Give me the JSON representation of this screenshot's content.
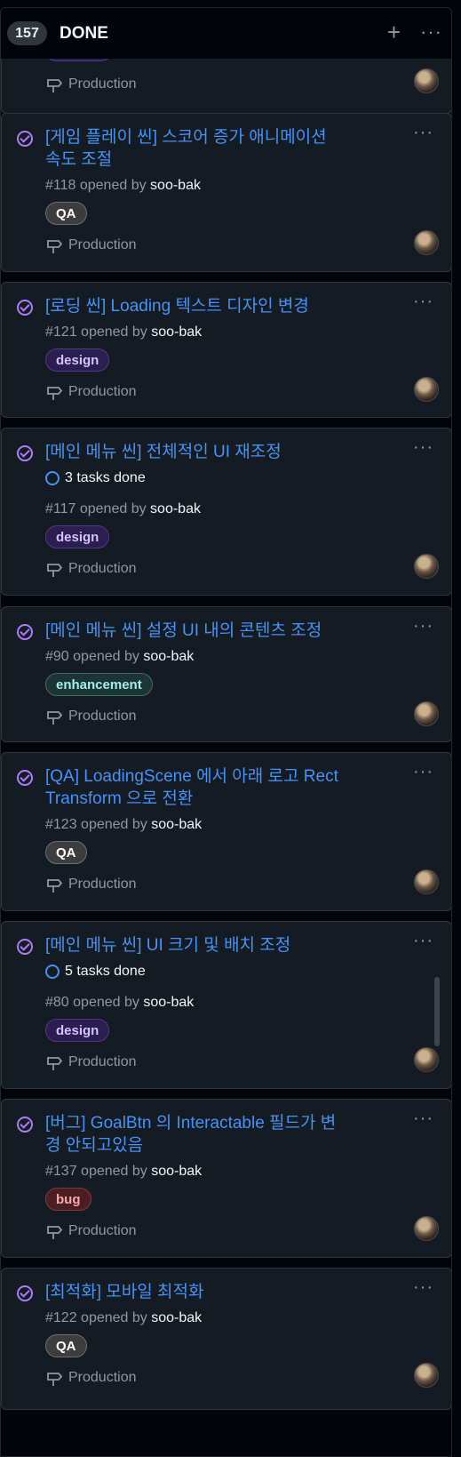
{
  "column": {
    "count": "157",
    "title": "DONE",
    "add_icon": "plus-icon",
    "more_icon": "kebab-horizontal-icon"
  },
  "partial_card": {
    "milestone": "Production"
  },
  "cards": [
    {
      "title_line1": "[게임 플레이 씬] 스코어 증가 애니메이션",
      "title_line2": "속도 조절",
      "number": "#118",
      "opened_by": "opened by",
      "author": "soo-bak",
      "label": "QA",
      "milestone": "Production"
    },
    {
      "title_line1": "[로딩 씬] Loading 텍스트 디자인 변경",
      "number": "#121",
      "opened_by": "opened by",
      "author": "soo-bak",
      "label": "design",
      "milestone": "Production"
    },
    {
      "title_line1": "[메인 메뉴 씬] 전체적인 UI 재조정",
      "tasks": "3 tasks done",
      "number": "#117",
      "opened_by": "opened by",
      "author": "soo-bak",
      "label": "design",
      "milestone": "Production"
    },
    {
      "title_line1": "[메인 메뉴 씬] 설정 UI 내의 콘텐츠 조정",
      "number": "#90",
      "opened_by": "opened by",
      "author": "soo-bak",
      "label": "enhancement",
      "milestone": "Production"
    },
    {
      "title_line1": "[QA] LoadingScene 에서 아래 로고 Rect",
      "title_line2": "Transform 으로 전환",
      "number": "#123",
      "opened_by": "opened by",
      "author": "soo-bak",
      "label": "QA",
      "milestone": "Production"
    },
    {
      "title_line1": "[메인 메뉴 씬] UI 크기 및 배치 조정",
      "tasks": "5 tasks done",
      "number": "#80",
      "opened_by": "opened by",
      "author": "soo-bak",
      "label": "design",
      "milestone": "Production"
    },
    {
      "title_line1": "[버그] GoalBtn 의 Interactable 필드가 변",
      "title_line2": "경 안되고있음",
      "number": "#137",
      "opened_by": "opened by",
      "author": "soo-bak",
      "label": "bug",
      "milestone": "Production"
    },
    {
      "title_line1": "[최적화] 모바일 최적화",
      "number": "#122",
      "opened_by": "opened by",
      "author": "soo-bak",
      "label": "QA",
      "milestone": "Production"
    }
  ],
  "colors": {
    "accent": "#4493f8",
    "done_purple": "#ab7df8",
    "card_bg": "#151b23",
    "page_bg": "#010409"
  }
}
